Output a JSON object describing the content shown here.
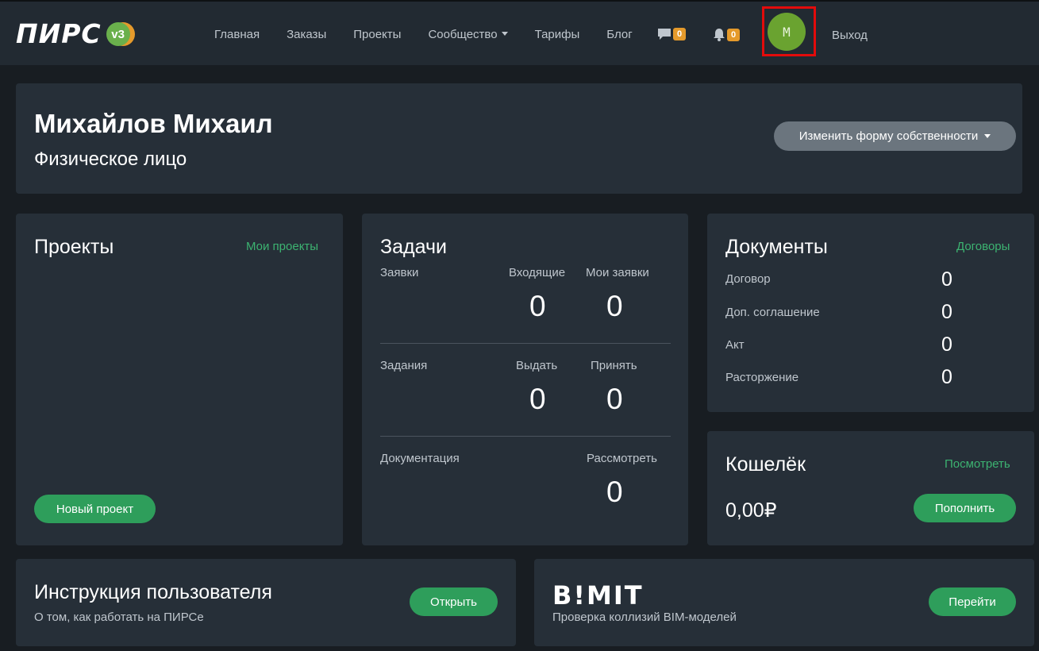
{
  "header": {
    "logo_text": "ПИРС",
    "logo_version": "v3",
    "nav": [
      "Главная",
      "Заказы",
      "Проекты",
      "Сообщество",
      "Тарифы",
      "Блог"
    ],
    "messages_count": "0",
    "notifications_count": "0",
    "avatar_letter": "M",
    "logout": "Выход"
  },
  "profile": {
    "name": "Михайлов Михаил",
    "type": "Физическое лицо",
    "change_button": "Изменить форму собственности"
  },
  "projects": {
    "title": "Проекты",
    "link": "Мои проекты",
    "new_button": "Новый проект"
  },
  "tasks": {
    "title": "Задачи",
    "requests_label": "Заявки",
    "incoming_label": "Входящие",
    "incoming_value": "0",
    "my_requests_label": "Мои заявки",
    "my_requests_value": "0",
    "assignments_label": "Задания",
    "issue_label": "Выдать",
    "issue_value": "0",
    "accept_label": "Принять",
    "accept_value": "0",
    "documentation_label": "Документация",
    "review_label": "Рассмотреть",
    "review_value": "0"
  },
  "documents": {
    "title": "Документы",
    "link": "Договоры",
    "rows": [
      {
        "label": "Договор",
        "value": "0"
      },
      {
        "label": "Доп. соглашение",
        "value": "0"
      },
      {
        "label": "Акт",
        "value": "0"
      },
      {
        "label": "Расторжение",
        "value": "0"
      }
    ]
  },
  "wallet": {
    "title": "Кошелёк",
    "link": "Посмотреть",
    "balance": "0,00₽",
    "topup_button": "Пополнить"
  },
  "guide": {
    "title": "Инструкция пользователя",
    "subtitle": "О том, как работать на ПИРСе",
    "button": "Открыть"
  },
  "bimit": {
    "logo": "B!MIT",
    "subtitle": "Проверка коллизий BIM-моделей",
    "button": "Перейти"
  }
}
